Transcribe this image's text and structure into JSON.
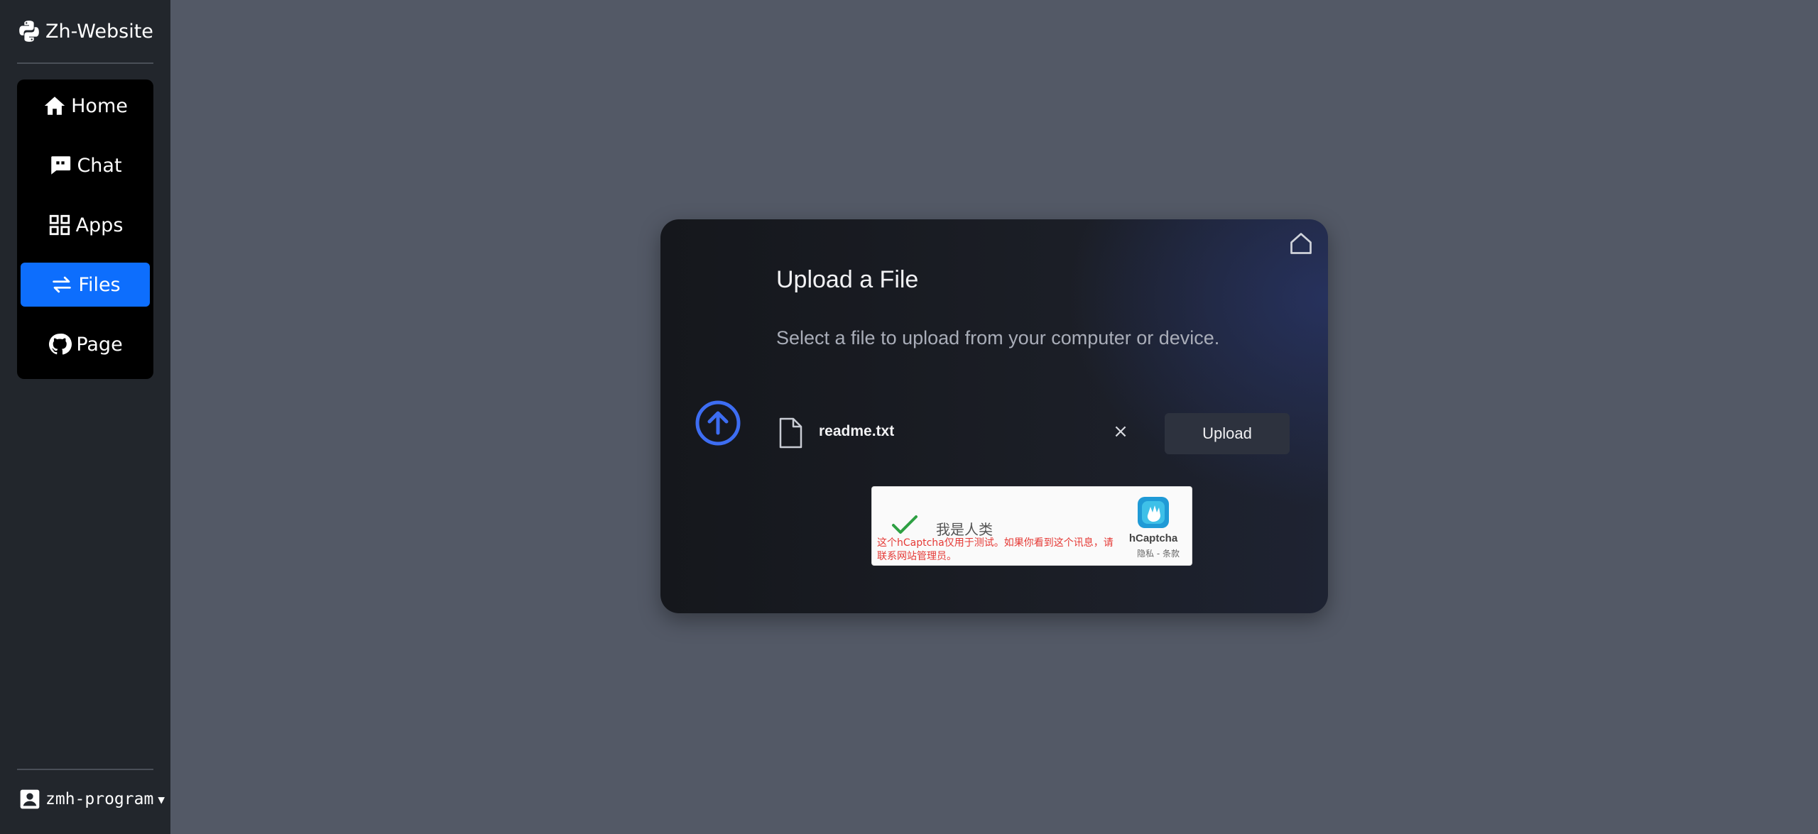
{
  "sidebar": {
    "brand": "Zh-Website",
    "items": [
      {
        "label": "Home",
        "icon": "home-icon",
        "active": false
      },
      {
        "label": "Chat",
        "icon": "chat-icon",
        "active": false
      },
      {
        "label": "Apps",
        "icon": "apps-grid-icon",
        "active": false
      },
      {
        "label": "Files",
        "icon": "swap-arrows-icon",
        "active": true
      },
      {
        "label": "Page",
        "icon": "github-icon",
        "active": false
      }
    ],
    "user": "zmh-program"
  },
  "upload": {
    "title": "Upload a File",
    "description": "Select a file to upload from your computer or device.",
    "file_name": "readme.txt",
    "remove_label": "×",
    "button_label": "Upload"
  },
  "captcha": {
    "label": "我是人类",
    "warning": "这个hCaptcha仅用于测试。如果你看到这个讯息，请联系网站管理员。",
    "brand": "hCaptcha",
    "links": "隐私 - 条款"
  },
  "colors": {
    "background": "#535966",
    "sidebar": "#22262c",
    "active_nav": "#0d6efd",
    "accent_icon": "#3d6df2"
  }
}
